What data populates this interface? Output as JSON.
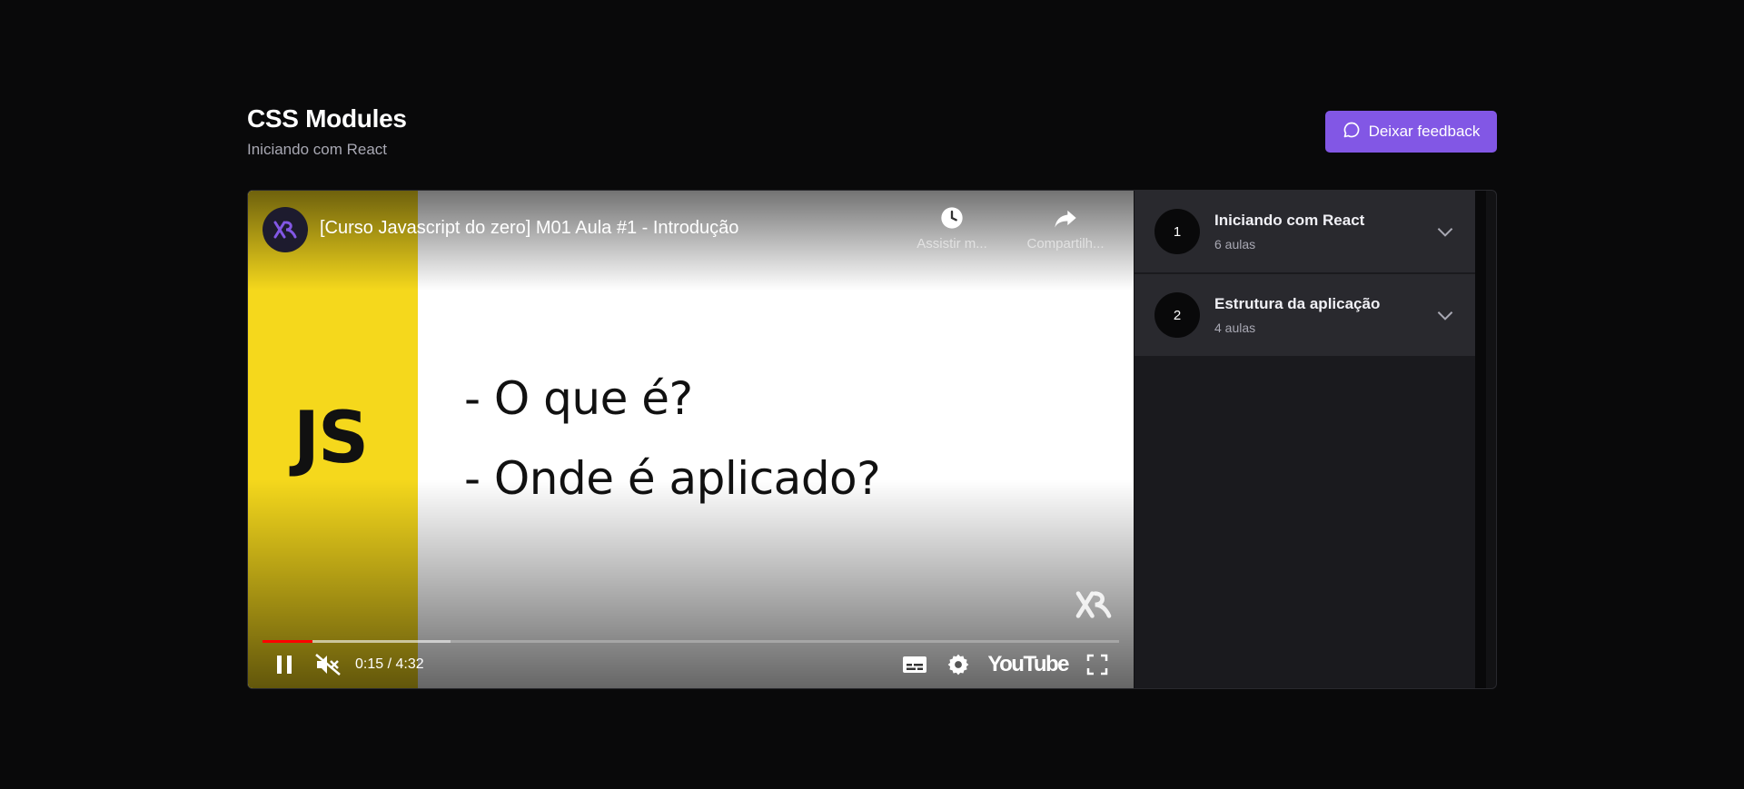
{
  "header": {
    "title": "CSS Modules",
    "subtitle": "Iniciando com React",
    "feedback_label": "Deixar feedback"
  },
  "player": {
    "video_title": "[Curso Javascript do zero] M01 Aula #1 - Introdução",
    "watch_later_label": "Assistir m...",
    "share_label": "Compartilh...",
    "slide": {
      "badge": "JS",
      "line1": "- O que é?",
      "line2": "- Onde é aplicado?"
    },
    "time": "0:15 / 4:32",
    "played_fraction": 0.058,
    "buffered_fraction": 0.22,
    "youtube_label": "YouTube"
  },
  "modules": [
    {
      "number": "1",
      "title": "Iniciando com React",
      "count": "6 aulas"
    },
    {
      "number": "2",
      "title": "Estrutura da aplicação",
      "count": "4 aulas"
    }
  ],
  "colors": {
    "accent": "#8257e5",
    "background": "#09090a",
    "panel": "#29292e",
    "js_yellow": "#f5d81c",
    "progress": "#ff0000"
  }
}
